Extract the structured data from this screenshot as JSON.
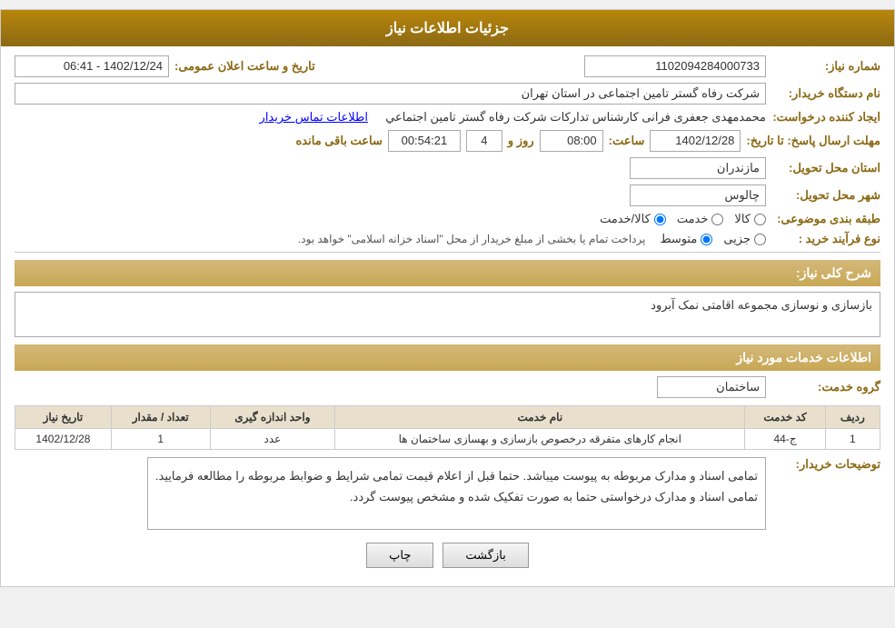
{
  "header": {
    "title": "جزئیات اطلاعات نیاز"
  },
  "need_number": {
    "label": "شماره نیاز:",
    "value": "1102094284000733"
  },
  "buyer_org": {
    "label": "نام دستگاه خریدار:",
    "value": "شرکت رفاه گستر تامین اجتماعی در استان تهران"
  },
  "creator": {
    "label": "ایجاد کننده درخواست:",
    "name": "محمدمهدی جعفری فرانی کارشناس تداركات شركت رفاه گستر تامين اجتماعي",
    "contact_link": "اطلاعات تماس خریدار"
  },
  "deadline": {
    "label": "مهلت ارسال پاسخ: تا تاریخ:",
    "date_label": "تاریخ:",
    "date_value": "1402/12/28",
    "time_label": "ساعت:",
    "time_value": "08:00",
    "days_label": "روز و",
    "days_value": "4",
    "remaining_label": "ساعت باقی مانده",
    "remaining_value": "00:54:21"
  },
  "announce": {
    "label": "تاریخ و ساعت اعلان عمومی:",
    "value": "1402/12/24 - 06:41"
  },
  "province": {
    "label": "استان محل تحویل:",
    "value": "مازندران"
  },
  "city": {
    "label": "شهر محل تحویل:",
    "value": "چالوس"
  },
  "category": {
    "label": "طبقه بندی موضوعی:",
    "options": [
      {
        "id": "kala",
        "label": "کالا",
        "checked": true
      },
      {
        "id": "khadamat",
        "label": "خدمت",
        "checked": false
      },
      {
        "id": "kala_khadamat",
        "label": "کالا/خدمت",
        "checked": false
      }
    ]
  },
  "purchase_type": {
    "label": "نوع فرآیند خرید :",
    "options": [
      {
        "id": "jozi",
        "label": "جزیی",
        "checked": false
      },
      {
        "id": "motevaset",
        "label": "متوسط",
        "checked": true
      }
    ],
    "note": "پرداخت تمام یا بخشی از مبلغ خریدار از محل \"اسناد خزانه اسلامی\" خواهد بود."
  },
  "description": {
    "label": "شرح کلی نیاز:",
    "value": "بازسازی و نوسازی مجموعه اقامتی نمک آبرود"
  },
  "services_header": "اطلاعات خدمات مورد نیاز",
  "service_group": {
    "label": "گروه خدمت:",
    "value": "ساختمان"
  },
  "table": {
    "headers": [
      "ردیف",
      "کد خدمت",
      "نام خدمت",
      "واحد اندازه گیری",
      "تعداد / مقدار",
      "تاریخ نیاز"
    ],
    "rows": [
      {
        "row": "1",
        "code": "ج-44",
        "name": "انجام کارهای متفرقه درخصوص بازسازی و بهسازی ساختمان ها",
        "unit": "عدد",
        "qty": "1",
        "date": "1402/12/28"
      }
    ]
  },
  "buyer_notes": {
    "label": "توضیحات خریدار:",
    "line1": "تمامی اسناد و مدارک مربوطه به پیوست میباشد. حتما قبل از اعلام قیمت تمامی شرایط و ضوابط مربوطه را مطالعه فرمایید.",
    "line2": "تمامی اسناد و مدارک درخواستی حتما به صورت تفکیک شده و مشخص پیوست گردد."
  },
  "buttons": {
    "back": "بازگشت",
    "print": "چاپ"
  }
}
